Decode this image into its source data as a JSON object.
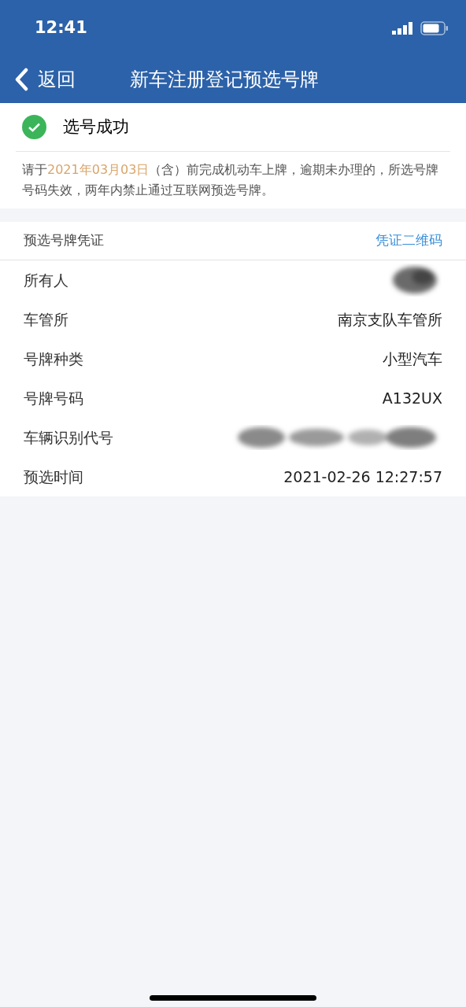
{
  "status_bar": {
    "time": "12:41"
  },
  "nav": {
    "back": "返回",
    "title": "新车注册登记预选号牌"
  },
  "result": {
    "success": true,
    "title": "选号成功"
  },
  "notice": "请于**2021年03月03日**（含）前完成机动车上牌，逾期未办理的，所选号牌号码失效，两年内禁止通过互联网预选号牌。",
  "voucher": {
    "title": "预选号牌凭证",
    "link": "凭证二维码",
    "rows": [
      {
        "label": "所有人",
        "kind": "redacted"
      },
      {
        "label": "车管所",
        "kind": "text",
        "value": "南京支队车管所"
      },
      {
        "label": "号牌种类",
        "kind": "text",
        "value": "小型汽车"
      },
      {
        "label": "号牌号码",
        "kind": "text",
        "value": "A132UX"
      },
      {
        "label": "车辆识别代号",
        "kind": "redacted-wide"
      },
      {
        "label": "预选时间",
        "kind": "text",
        "value": "2021-02-26 12:27:57"
      }
    ]
  }
}
